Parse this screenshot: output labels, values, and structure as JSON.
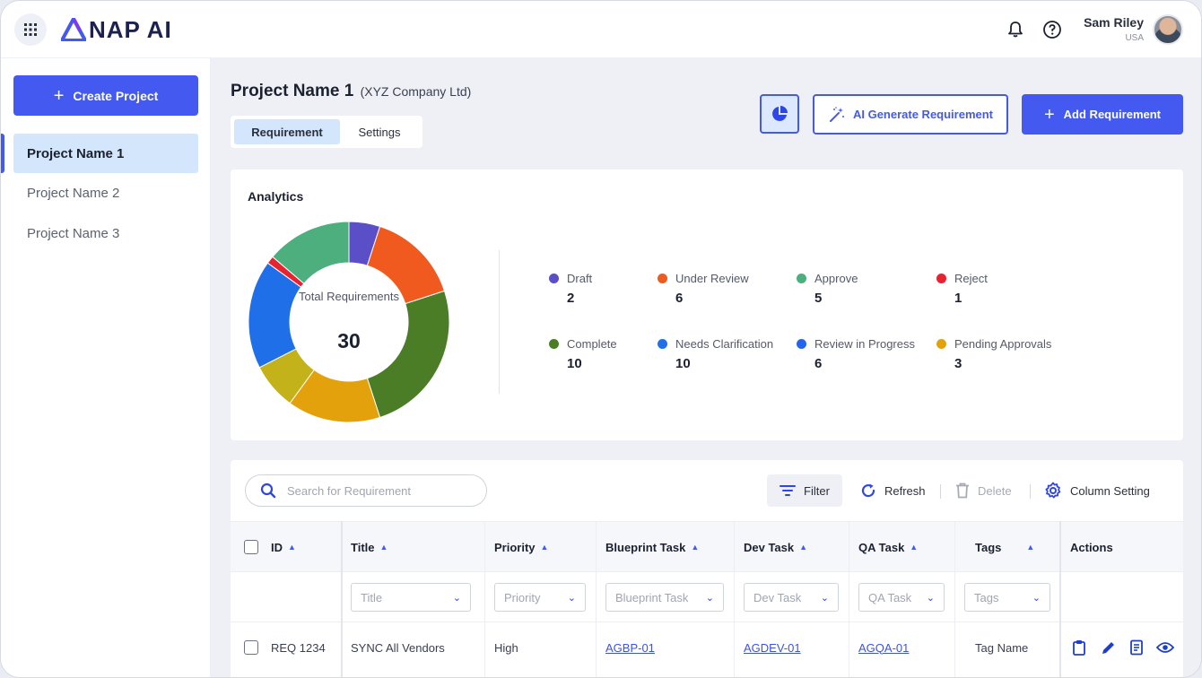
{
  "header": {
    "logo_text": "NAP AI",
    "user_name": "Sam Riley",
    "user_location": "USA"
  },
  "sidebar": {
    "create_label": "Create Project",
    "projects": [
      {
        "label": "Project Name 1",
        "active": true
      },
      {
        "label": "Project Name 2",
        "active": false
      },
      {
        "label": "Project Name 3",
        "active": false
      }
    ]
  },
  "page": {
    "project_name": "Project Name 1",
    "company": "(XYZ Company Ltd)",
    "tabs": [
      {
        "label": "Requirement",
        "active": true
      },
      {
        "label": "Settings",
        "active": false
      }
    ],
    "ai_button": "AI Generate Requirement",
    "add_button": "Add Requirement"
  },
  "analytics": {
    "title": "Analytics",
    "center_label": "Total Requirements",
    "total": "30",
    "statuses": [
      {
        "name": "Draft",
        "value": 2,
        "color": "#5b4fc8"
      },
      {
        "name": "Under Review",
        "value": 6,
        "color": "#f05a1f"
      },
      {
        "name": "Approve",
        "value": 5,
        "color": "#4caf7d"
      },
      {
        "name": "Reject",
        "value": 1,
        "color": "#e8232f"
      },
      {
        "name": "Complete",
        "value": 10,
        "color": "#4a7d26"
      },
      {
        "name": "Needs Clarification",
        "value": 10,
        "color": "#1f6fe8"
      },
      {
        "name": "Review in Progress",
        "value": 6,
        "color": "#2465f0"
      },
      {
        "name": "Pending Approvals",
        "value": 3,
        "color": "#e3a20b"
      }
    ],
    "donut_segments": [
      {
        "name": "Draft",
        "value": 2,
        "color": "#5b4fc8"
      },
      {
        "name": "Under Review",
        "value": 6,
        "color": "#f05a1f"
      },
      {
        "name": "Complete",
        "value": 10,
        "color": "#4a7d26"
      },
      {
        "name": "Pending Approvals",
        "value": 6,
        "color": "#e3a20b"
      },
      {
        "name": "Other",
        "value": 3,
        "color": "#c4b21a"
      },
      {
        "name": "Needs Clarification",
        "value": 7,
        "color": "#1f6fe8"
      },
      {
        "name": "Reject",
        "value": 0.5,
        "color": "#e8232f"
      },
      {
        "name": "Approve",
        "value": 5.5,
        "color": "#4caf7d"
      }
    ]
  },
  "table": {
    "search_placeholder": "Search for Requirement",
    "toolbar": {
      "filter": "Filter",
      "refresh": "Refresh",
      "delete": "Delete",
      "column_setting": "Column Setting"
    },
    "columns": [
      "ID",
      "Title",
      "Priority",
      "Blueprint Task",
      "Dev Task",
      "QA Task",
      "Tags",
      "Actions"
    ],
    "filter_placeholders": [
      "Title",
      "Priority",
      "Blueprint Task",
      "Dev Task",
      "QA Task",
      "Tags"
    ],
    "rows": [
      {
        "id": "REQ 1234",
        "title": "SYNC All Vendors",
        "priority": "High",
        "blueprint": "AGBP-01",
        "dev": "AGDEV-01",
        "qa": "AGQA-01",
        "tags": "Tag Name"
      }
    ]
  }
}
